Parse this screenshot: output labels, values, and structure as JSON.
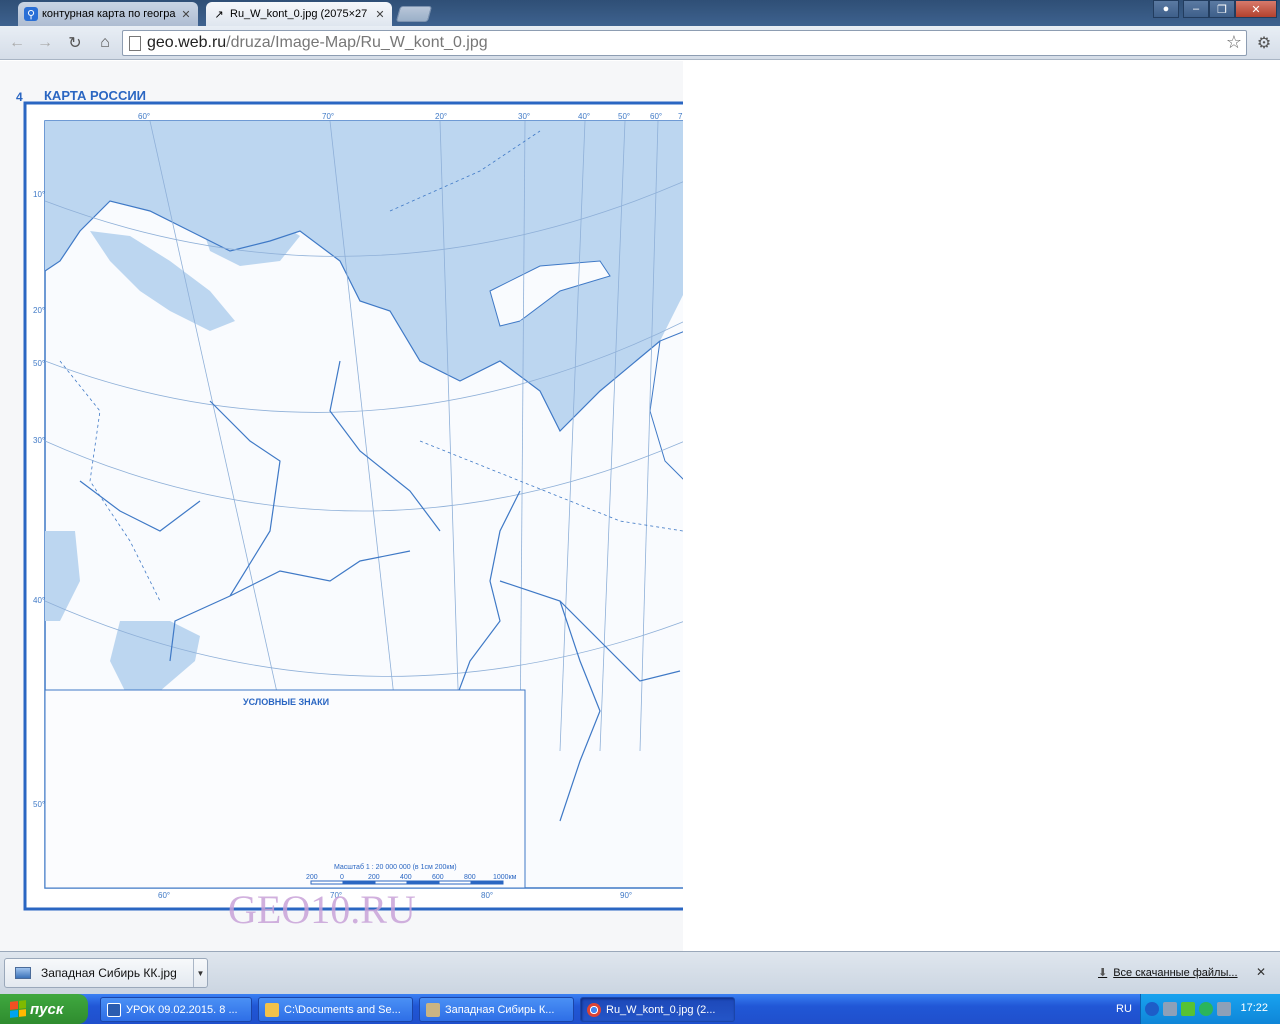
{
  "browser": {
    "tabs": [
      {
        "title": "контурная карта по геогра",
        "active": false,
        "icon": "search-favicon"
      },
      {
        "title": "Ru_W_kont_0.jpg (2075×27",
        "active": true,
        "icon": "image-favicon"
      }
    ],
    "url_host": "geo.web.ru",
    "url_path": "/druza/Image-Map/Ru_W_kont_0.jpg"
  },
  "map": {
    "page_number": "4",
    "title": "КАРТА РОССИИ",
    "legend_title": "УСЛОВНЫЕ ЗНАКИ",
    "scale_label": "Масштаб   1 : 20 000 000   (в 1см 200км)",
    "scale_ticks": [
      "200",
      "0",
      "200",
      "400",
      "600",
      "800",
      "1000км"
    ],
    "top_degrees": [
      "60°",
      "70°",
      "20°",
      "30°",
      "40°",
      "50°",
      "60°",
      "7"
    ],
    "left_degrees": [
      "10°",
      "20°",
      "50°",
      "30°",
      "40°",
      "50°"
    ],
    "bottom_degrees": [
      "60°",
      "70°",
      "80°",
      "90°"
    ],
    "watermark": "GEO10.RU",
    "colors": {
      "water": "#bcd6f0",
      "lines": "#3f79c6",
      "frame": "#2a66c2",
      "watermark": "#c9a3d9"
    }
  },
  "downloads": {
    "item_name": "Западная Сибирь КК.jpg",
    "show_all": "Все скачанные файлы..."
  },
  "taskbar": {
    "start_label": "пуск",
    "buttons": [
      {
        "label": "УРОК 09.02.2015. 8 ...",
        "icon": "word-icon"
      },
      {
        "label": "C:\\Documents and Se...",
        "icon": "folder-icon"
      },
      {
        "label": "Западная Сибирь К...",
        "icon": "viewer-icon"
      },
      {
        "label": "Ru_W_kont_0.jpg (2...",
        "icon": "chrome-icon",
        "active": true
      }
    ],
    "language": "RU",
    "clock": "17:22"
  }
}
